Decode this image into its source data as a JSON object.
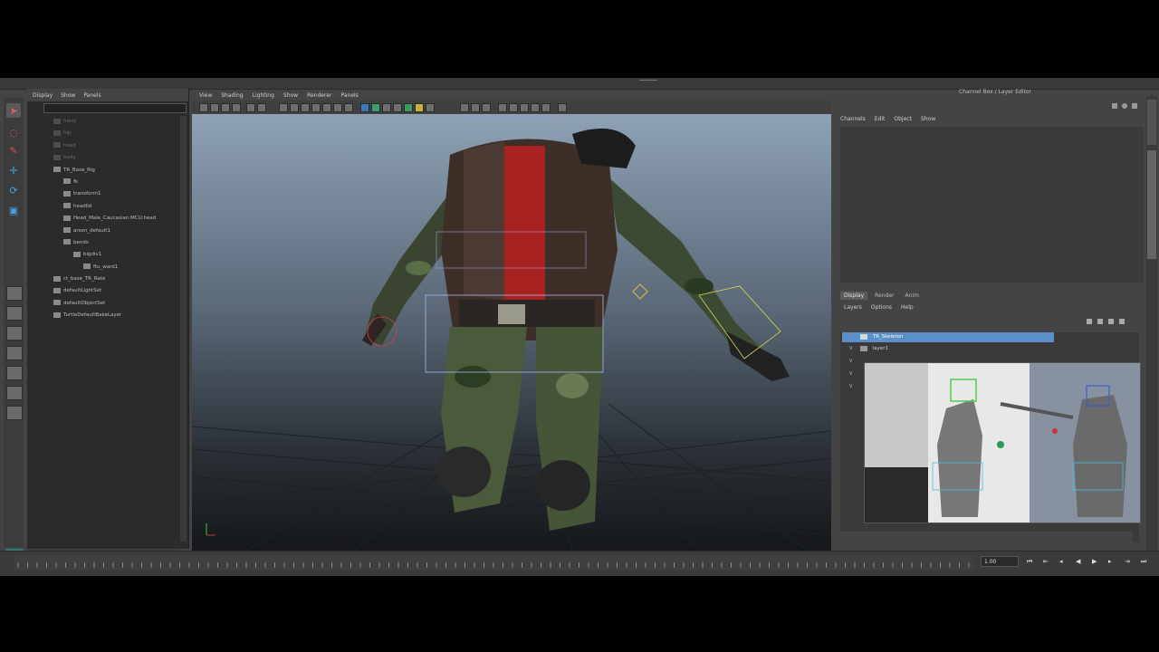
{
  "window": {
    "title": "Channel Box / Layer Editor"
  },
  "outliner": {
    "menu": [
      "Display",
      "Show",
      "Panels"
    ],
    "items": [
      {
        "label": "hand",
        "dim": true,
        "indent": 1
      },
      {
        "label": "hip",
        "dim": true,
        "indent": 1
      },
      {
        "label": "head",
        "dim": true,
        "indent": 1
      },
      {
        "label": "body",
        "dim": true,
        "indent": 1
      },
      {
        "label": "TR_Base_Rig",
        "dim": false,
        "indent": 1
      },
      {
        "label": "fk",
        "dim": false,
        "indent": 2
      },
      {
        "label": "transform1",
        "dim": false,
        "indent": 2
      },
      {
        "label": "headlid",
        "dim": false,
        "indent": 2
      },
      {
        "label": "Head_Male_Caucasian:MCU:head",
        "dim": false,
        "indent": 2
      },
      {
        "label": "arsen_default1",
        "dim": false,
        "indent": 2
      },
      {
        "label": "bends",
        "dim": false,
        "indent": 2
      },
      {
        "label": "bigdiv1",
        "dim": false,
        "indent": 3
      },
      {
        "label": "ftu_ward1",
        "dim": false,
        "indent": 4
      },
      {
        "label": "ct_base_TR_Rate",
        "dim": false,
        "indent": 1
      },
      {
        "label": "defaultLightSet",
        "dim": false,
        "indent": 1
      },
      {
        "label": "defaultObjectSet",
        "dim": false,
        "indent": 1
      },
      {
        "label": "TurtleDefaultBakeLayer",
        "dim": false,
        "indent": 1
      }
    ]
  },
  "viewport": {
    "menu": [
      "View",
      "Shading",
      "Lighting",
      "Show",
      "Renderer",
      "Panels"
    ]
  },
  "channel_box": {
    "title": "Channel Box / Layer Editor",
    "menu": [
      "Channels",
      "Edit",
      "Object",
      "Show"
    ]
  },
  "layer_editor": {
    "tabs": [
      "Display",
      "Render",
      "Anim"
    ],
    "active_tab": "Display",
    "menu": [
      "Layers",
      "Options",
      "Help"
    ],
    "rows": [
      {
        "label": "TR_Skeleton",
        "selected": true
      },
      {
        "label": "layer1",
        "selected": false
      }
    ],
    "v_marks": [
      "V",
      "V",
      "V",
      "V"
    ]
  },
  "timeline": {
    "current_frame": "1.00"
  },
  "colors": {
    "accent": "#5a8fc9",
    "active_tool": "#c03a3a",
    "panel_bg": "#444444"
  }
}
